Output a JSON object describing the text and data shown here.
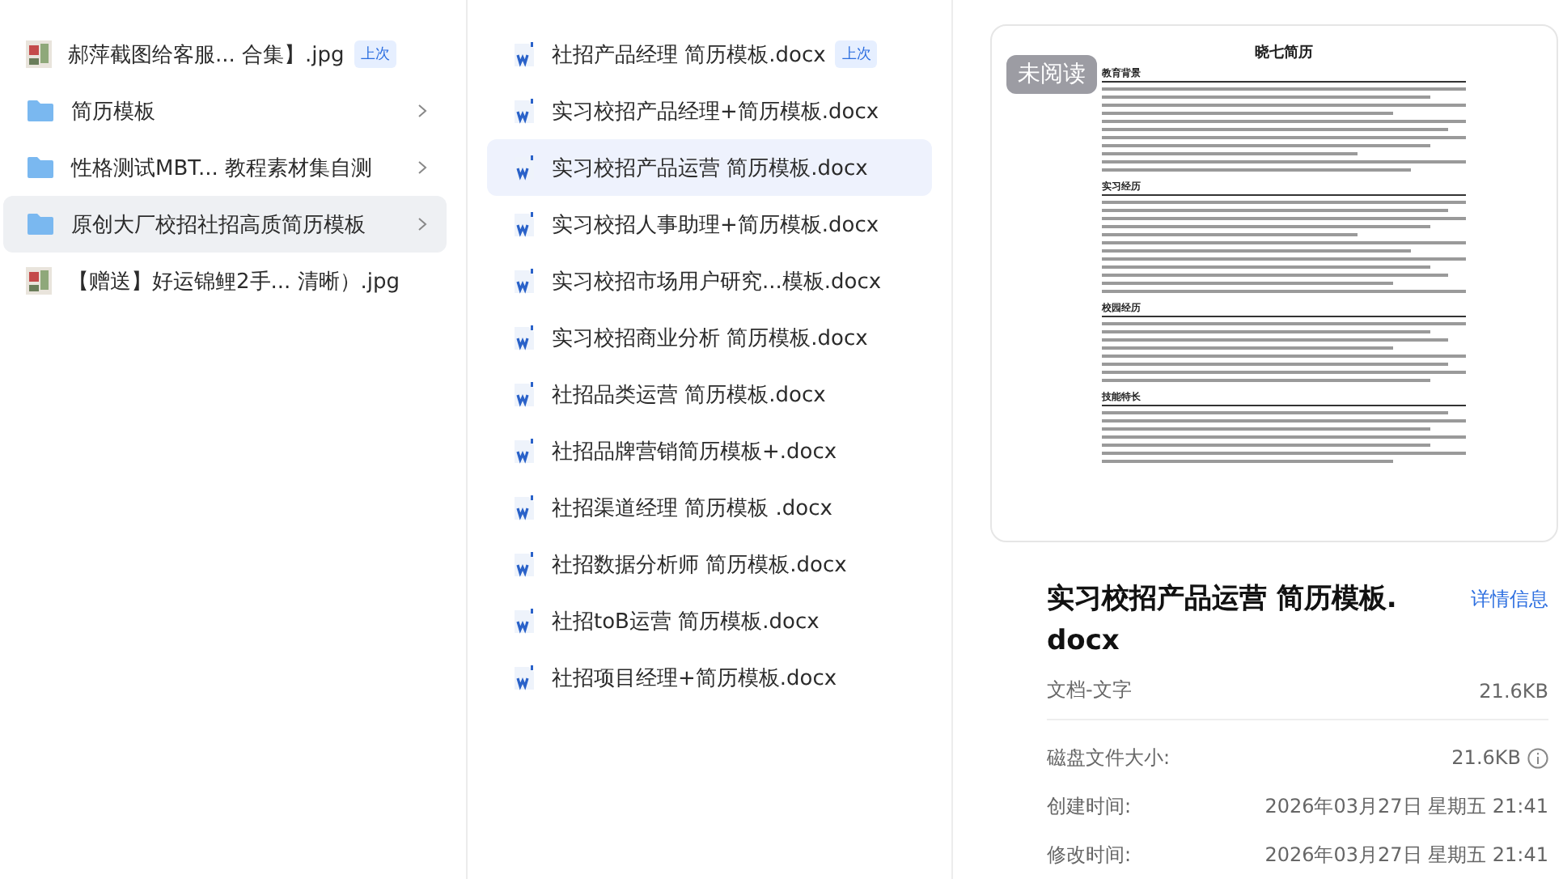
{
  "folders": {
    "items": [
      {
        "kind": "image",
        "name": "郝萍截图给客服... 合集】.jpg",
        "badge": "上次",
        "selected": false
      },
      {
        "kind": "folder",
        "name": "简历模板",
        "selected": false
      },
      {
        "kind": "folder",
        "name": "性格测试MBT... 教程素材集自测",
        "selected": false
      },
      {
        "kind": "folder",
        "name": "原创大厂校招社招高质简历模板",
        "selected": true
      },
      {
        "kind": "image",
        "name": "【赠送】好运锦鲤2手... 清晰）.jpg",
        "selected": false
      }
    ]
  },
  "files": {
    "items": [
      {
        "name": "社招产品经理 简历模板.docx",
        "badge": "上次",
        "selected": false
      },
      {
        "name": "实习校招产品经理+简历模板.docx",
        "selected": false
      },
      {
        "name": "实习校招产品运营 简历模板.docx",
        "selected": true
      },
      {
        "name": "实习校招人事助理+简历模板.docx",
        "selected": false
      },
      {
        "name": "实习校招市场用户研究...模板.docx",
        "selected": false
      },
      {
        "name": "实习校招商业分析 简历模板.docx",
        "selected": false
      },
      {
        "name": "社招品类运营 简历模板.docx",
        "selected": false
      },
      {
        "name": "社招品牌营销简历模板+.docx",
        "selected": false
      },
      {
        "name": "社招渠道经理 简历模板 .docx",
        "selected": false
      },
      {
        "name": "社招数据分析师 简历模板.docx",
        "selected": false
      },
      {
        "name": "社招toB运营 简历模板.docx",
        "selected": false
      },
      {
        "name": "社招项目经理+简历模板.docx",
        "selected": false
      }
    ]
  },
  "preview": {
    "badge": "未阅读",
    "document": {
      "title": "晓七简历",
      "sections": [
        "教育背景",
        "实习经历",
        "校园经历",
        "技能特长"
      ]
    }
  },
  "details": {
    "title": "实习校招产品运营 简历模板.docx",
    "link": "详情信息",
    "type": "文档-文字",
    "size": "21.6KB",
    "rows": [
      {
        "label": "磁盘文件大小:",
        "value": "21.6KB",
        "info": true
      },
      {
        "label": "创建时间:",
        "value": "2026年03月27日 星期五 21:41",
        "info": false
      },
      {
        "label": "修改时间:",
        "value": "2026年03月27日 星期五 21:41",
        "info": false
      }
    ]
  }
}
